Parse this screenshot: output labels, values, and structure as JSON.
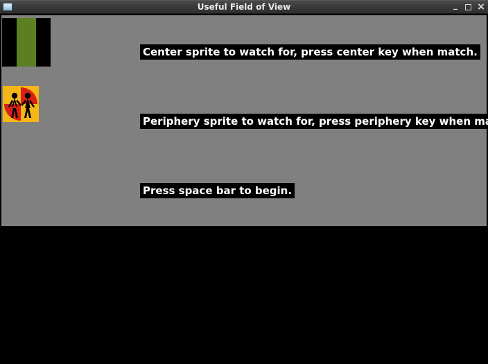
{
  "window": {
    "title": "Useful Field of View"
  },
  "instructions": {
    "center": "Center sprite to watch for, press center key when match.",
    "periphery": "Periphery sprite to watch for, press periphery key when match.",
    "begin": "Press space bar to begin."
  },
  "sprites": {
    "center": "green-bar-sprite",
    "periphery": "children-crossing-sign"
  },
  "colors": {
    "client_bg": "#808080",
    "text_bg": "#000000",
    "text_fg": "#ffffff"
  }
}
